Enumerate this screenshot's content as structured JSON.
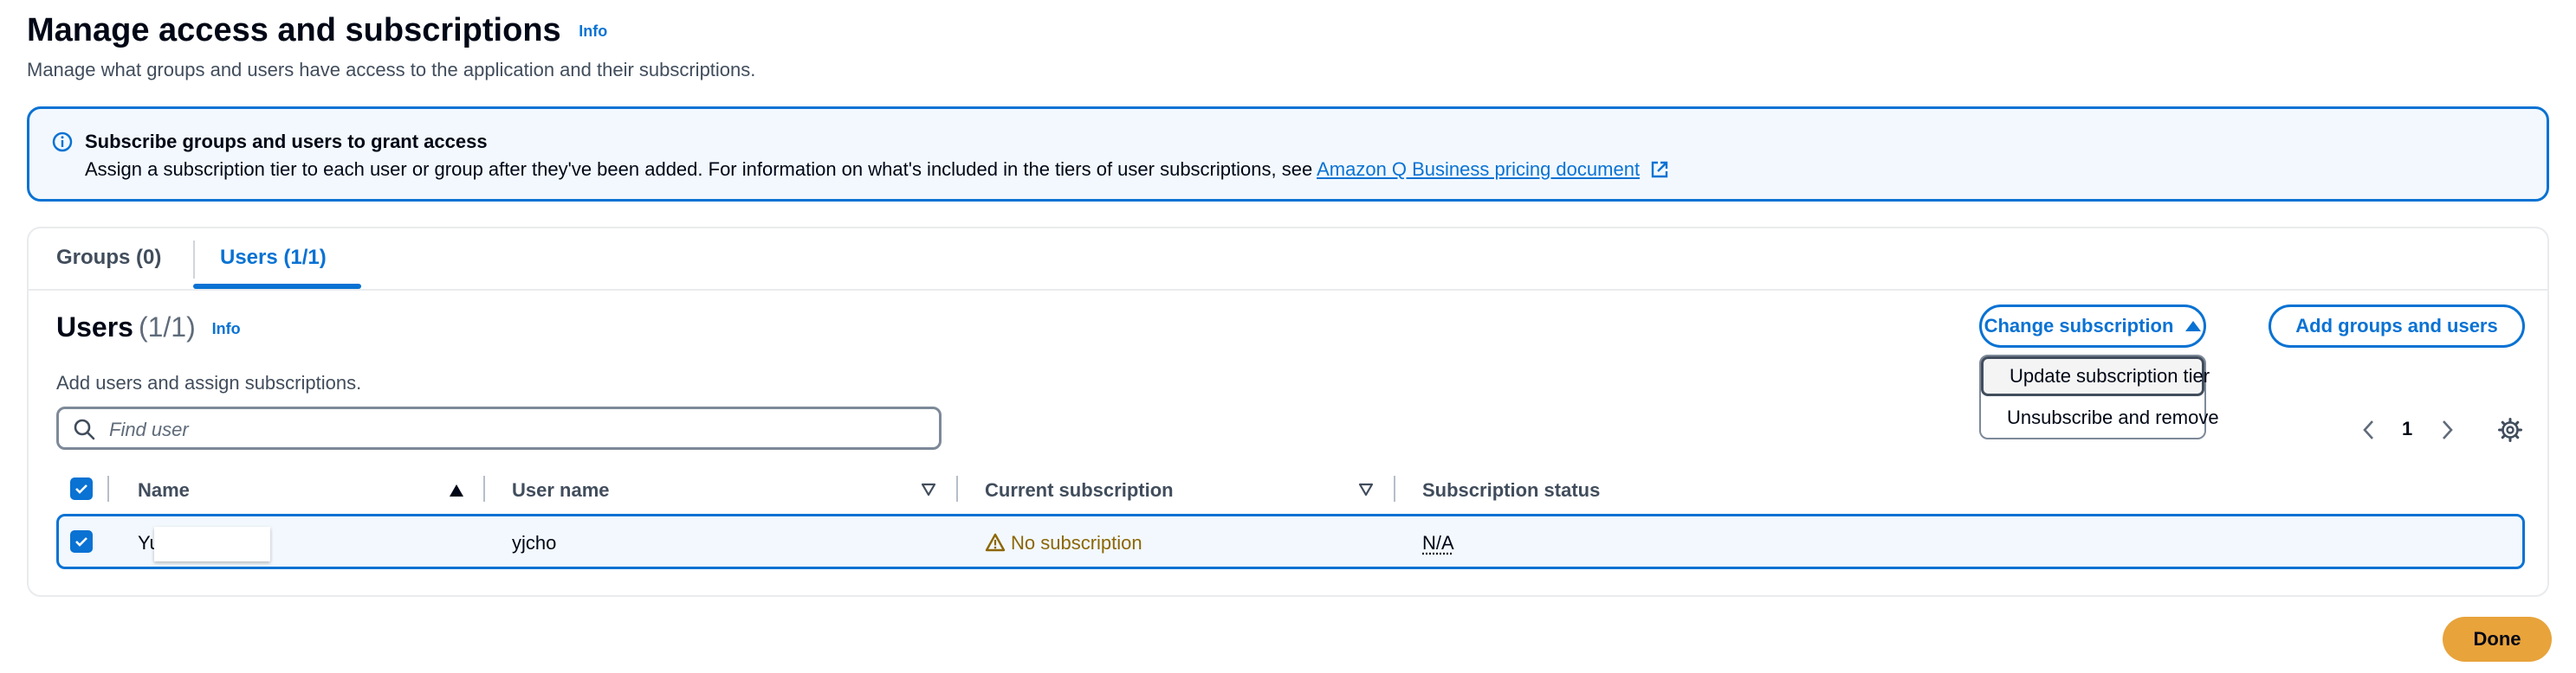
{
  "header": {
    "title": "Manage access and subscriptions",
    "info": "Info",
    "description": "Manage what groups and users have access to the application and their subscriptions."
  },
  "alert": {
    "title": "Subscribe groups and users to grant access",
    "body": "Assign a subscription tier to each user or group after they've been added. For information on what's included in the tiers of user subscriptions, see",
    "link": "Amazon Q Business pricing document",
    "icon": "info-circle-icon",
    "link_icon": "external-link-icon"
  },
  "tabs": [
    {
      "label": "Groups (0)",
      "selected": false
    },
    {
      "label": "Users (1/1)",
      "selected": true
    }
  ],
  "users_panel": {
    "title": "Users",
    "count": "(1/1)",
    "info": "Info",
    "description": "Add users and assign subscriptions.",
    "change_button": "Change subscription",
    "add_button": "Add groups and users",
    "menu": [
      "Update subscription tier",
      "Unsubscribe and remove"
    ],
    "search_placeholder": "Find user",
    "page": "1"
  },
  "table": {
    "columns": [
      "Name",
      "User name",
      "Current subscription",
      "Subscription status"
    ],
    "rows": [
      {
        "name": "Yu",
        "user_name": "yjcho",
        "subscription": "No subscription",
        "status": "N/A",
        "selected": true
      }
    ]
  },
  "footer": {
    "done": "Done"
  },
  "colors": {
    "accent": "#0972d3",
    "warning": "#8d6605",
    "primary_button": "#e8a33b"
  }
}
